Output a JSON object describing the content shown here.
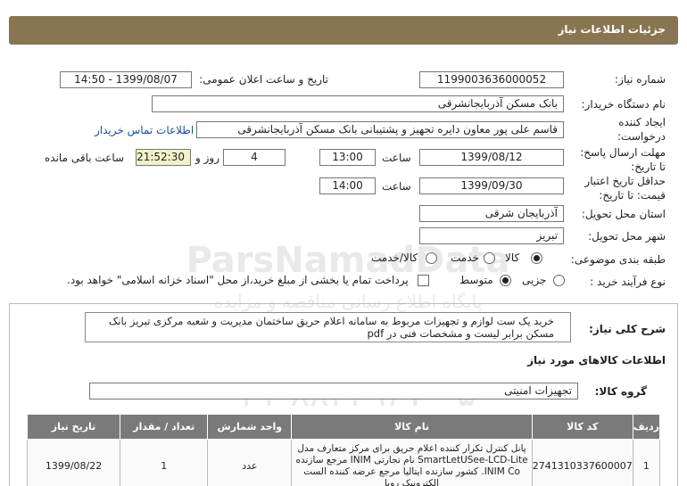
{
  "header": {
    "title": "جزئیات اطلاعات نیاز"
  },
  "form": {
    "need_number_label": "شماره نیاز:",
    "need_number": "1199003636000052",
    "announce_label": "تاریخ و ساعت اعلان عمومی:",
    "announce_value": "1399/08/07 - 14:50",
    "buyer_org_label": "نام دستگاه خریدار:",
    "buyer_org": "بانک مسکن آذربایجانشرقی",
    "creator_label_1": "ایجاد کننده",
    "creator_label_2": "درخواست:",
    "creator": "قاسم علی پور معاون دایره تجهیز و پشتیبانی بانک مسکن آذربایجانشرقی",
    "contact_link": "اطلاعات تماس خریدار",
    "deadline_label_1": "مهلت ارسال پاسخ:",
    "deadline_label_2": "تا تاریخ:",
    "deadline_date": "1399/08/12",
    "time_label": "ساعت",
    "deadline_time": "13:00",
    "days_value": "4",
    "days_label": "روز و",
    "remaining_time": "21:52:30",
    "remaining_label": "ساعت باقی مانده",
    "validity_label_1": "حداقل تاریخ اعتبار",
    "validity_label_2": "قیمت: تا تاریخ:",
    "validity_date": "1399/09/30",
    "validity_time": "14:00",
    "province_label": "استان محل تحویل:",
    "province": "آذربایجان شرقی",
    "city_label": "شهر محل تحویل:",
    "city": "تبریز",
    "category_label": "طبقه بندی موضوعی:",
    "category_options": [
      "کالا",
      "خدمت",
      "کالا/خدمت"
    ],
    "process_label": "نوع فرآیند خرید :",
    "process_options": [
      "جزیی",
      "متوسط"
    ],
    "payment_note": "پرداخت تمام یا بخشی از مبلغ خرید،از محل \"اسناد خزانه اسلامی\" خواهد بود."
  },
  "details": {
    "desc_label": "شرح کلی نیاز:",
    "description": "خرید یک ست لوازم و تجهیزات مربوط به سامانه اعلام حریق ساختمان مدیریت و شعبه مرکزی تبریز بانک مسکن برابر لیست و مشخصات فنی در pdf",
    "goods_title": "اطلاعات کالاهای مورد نیاز",
    "group_label": "گروه کالا:",
    "group_value": "تجهیزات امنیتی"
  },
  "table": {
    "headers": [
      "ردیف",
      "کد کالا",
      "نام کالا",
      "واحد شمارش",
      "تعداد / مقدار",
      "تاریخ نیاز"
    ],
    "rows": [
      {
        "index": "1",
        "code": "2741310337600007",
        "name": "پانل کنترل تکرار کننده اعلام حریق برای مرکز متعارف مدل SmartLetUSee-LCD-Lite نام تجارتی INIM مرجع سازنده INIM Co. کشور سازنده ایتالیا مرجع عرضه کننده الست الکترونیک رویا",
        "unit": "عدد",
        "qty": "1",
        "date": "1399/08/22"
      }
    ]
  },
  "watermark": {
    "line1": "ParsNamadData",
    "line2": "پایگاه اطلاع رسانی مناقصه و مزایده",
    "phone": "۰۲۱-۸۸۳۴۹۶۷۰-۵"
  },
  "colors": {
    "titlebar": "#8a7553",
    "table_header": "#7a7a7a",
    "link": "#1a4fa0",
    "timer_bg": "#f2f2c8"
  }
}
